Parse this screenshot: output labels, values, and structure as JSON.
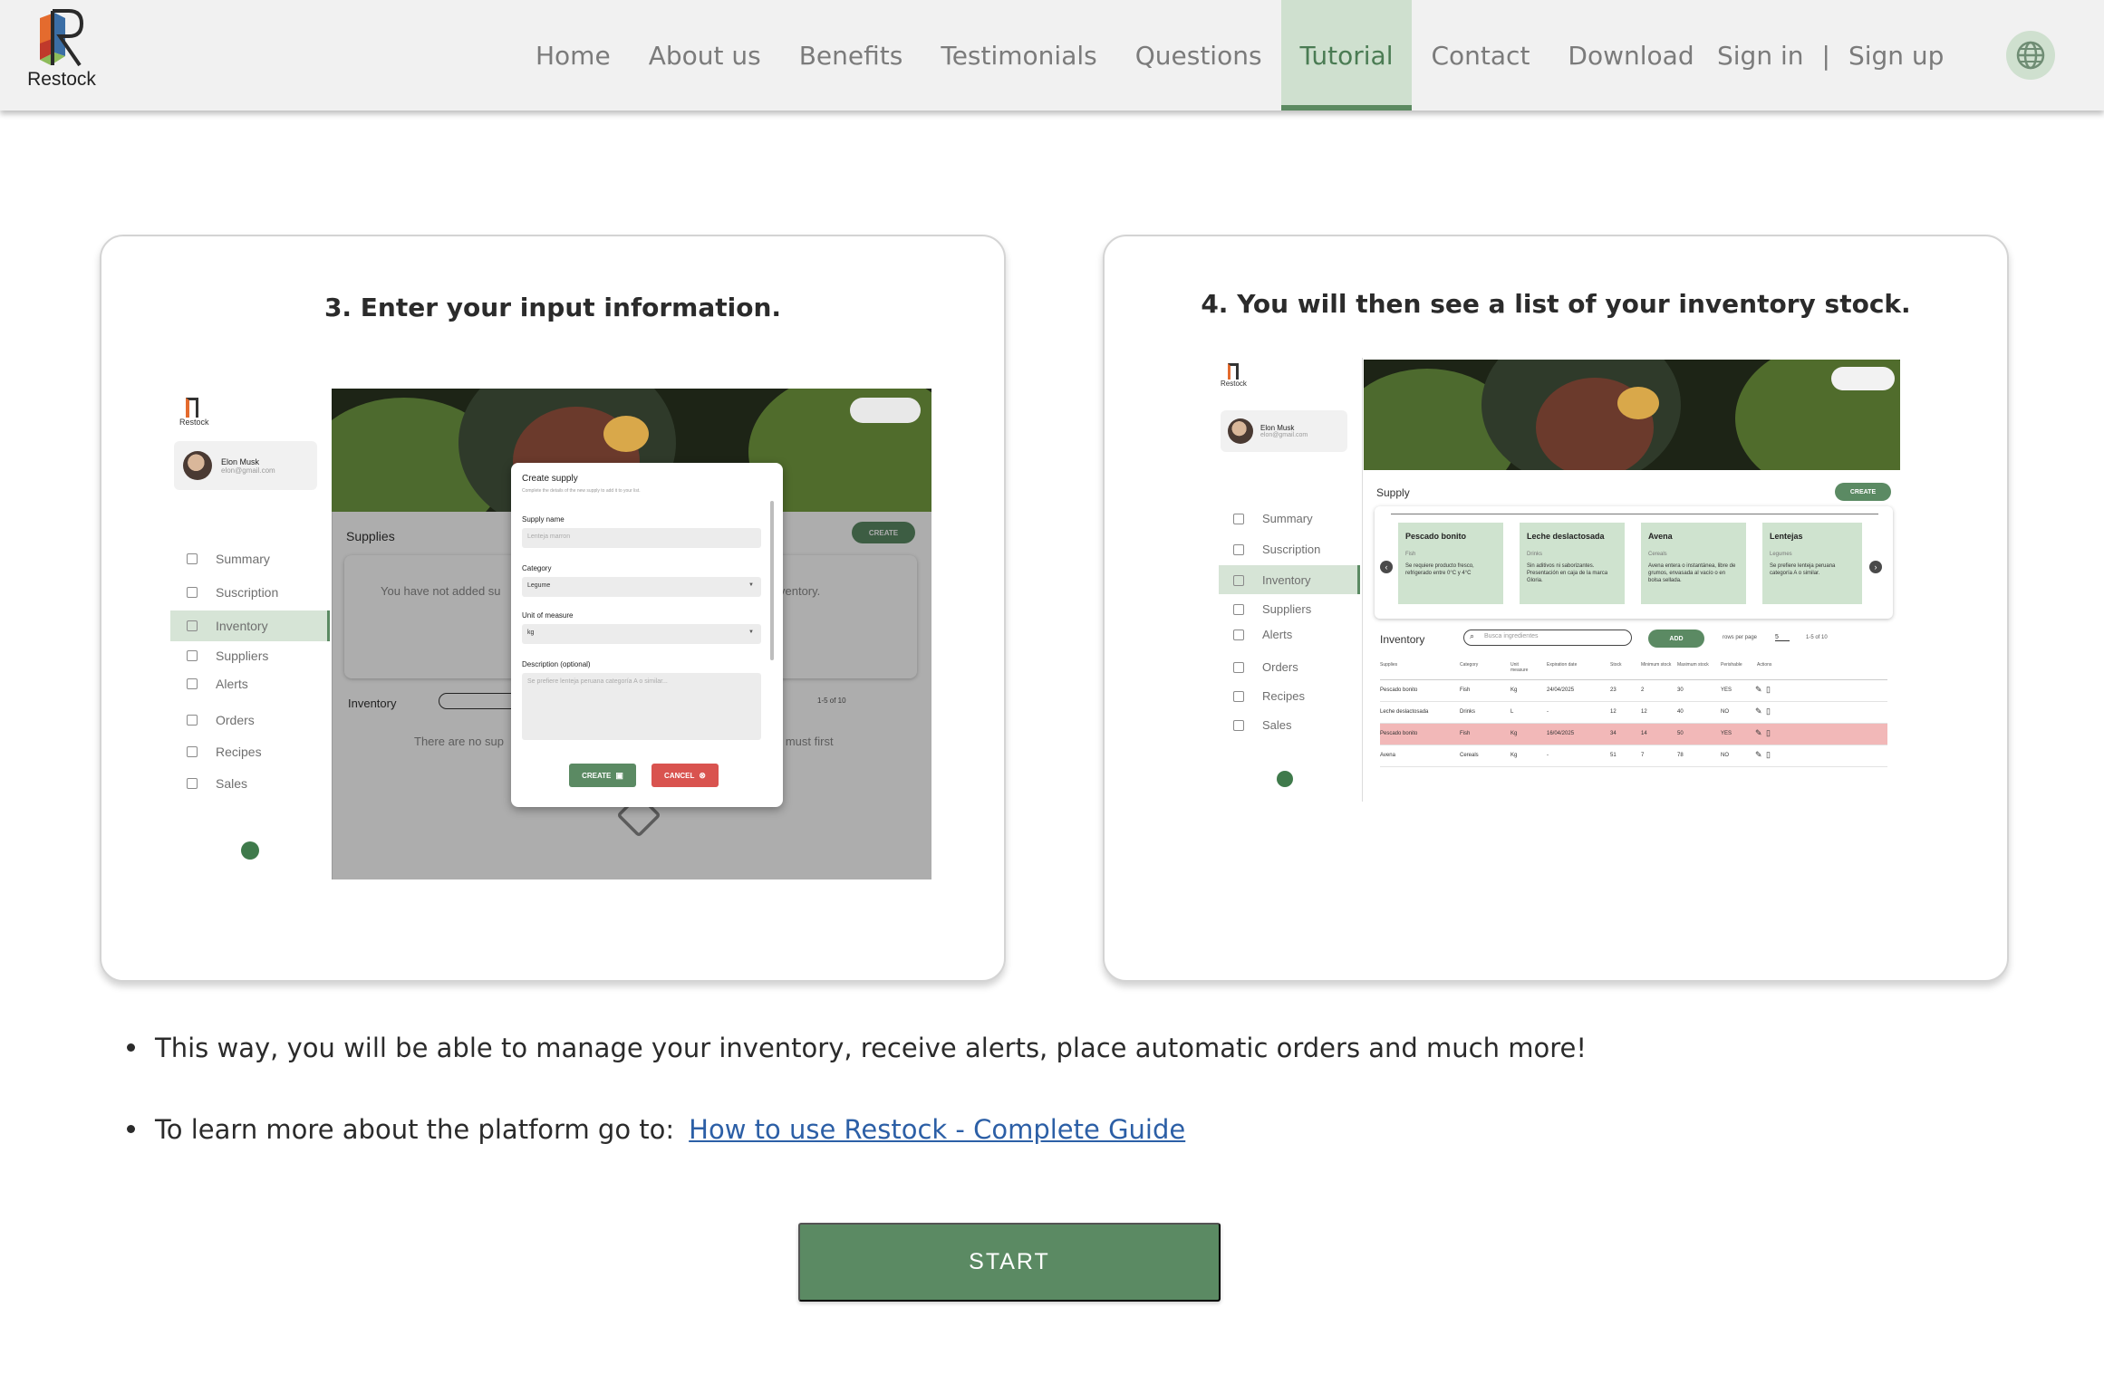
{
  "brand": {
    "name": "Restock"
  },
  "nav": {
    "items": [
      "Home",
      "About us",
      "Benefits",
      "Testimonials",
      "Questions",
      "Tutorial",
      "Contact",
      "Download"
    ],
    "active": "Tutorial",
    "sign_in": "Sign in",
    "separator": "|",
    "sign_up": "Sign up",
    "language_icon": "globe-icon"
  },
  "steps": [
    {
      "title": "3. Enter your input information.",
      "mock": {
        "brand": "Restock",
        "user_name": "Elon Musk",
        "user_email": "elon@gmail.com",
        "sidebar": [
          "Summary",
          "Suscription",
          "Inventory",
          "Suppliers",
          "Alerts",
          "Orders",
          "Recipes",
          "Sales"
        ],
        "active": "Inventory",
        "supplies_label": "Supplies",
        "create_label": "CREATE",
        "empty_text_left": "You have not added su",
        "empty_text_right": "ventory.",
        "inventory_label": "Inventory",
        "pagination": "1-5 of 10",
        "no_items_left": "There are no sup",
        "no_items_right": "u must first",
        "dialog": {
          "title": "Create supply",
          "subtitle": "Complete the details of the new supply to add it to your list.",
          "name_label": "Supply name",
          "name_placeholder": "Lenteja marron",
          "category_label": "Category",
          "category_value": "Legume",
          "unit_label": "Unit of measure",
          "unit_value": "kg",
          "desc_label": "Description (optional)",
          "desc_placeholder": "Se prefiere lenteja peruana categoría A o similar...",
          "create_button": "CREATE",
          "cancel_button": "CANCEL"
        }
      }
    },
    {
      "title": "4. You will then see a list of your inventory stock.",
      "mock": {
        "brand": "Restock",
        "user_name": "Elon Musk",
        "user_email": "elon@gmail.com",
        "sidebar": [
          "Summary",
          "Suscription",
          "Inventory",
          "Suppliers",
          "Alerts",
          "Orders",
          "Recipes",
          "Sales"
        ],
        "active": "Inventory",
        "supply_label": "Supply",
        "create_label": "CREATE",
        "cards": [
          {
            "name": "Pescado bonito",
            "category": "Fish",
            "desc": "Se requiere producto fresco, refrigerado entre 0°C y 4°C"
          },
          {
            "name": "Leche deslactosada",
            "category": "Drinks",
            "desc": "Sin aditivos ni saborizantes. Presentación en caja de la marca Gloria."
          },
          {
            "name": "Avena",
            "category": "Cereals",
            "desc": "Avena entera o instantánea, libre de grumos, envasada al vacío o en bolsa sellada."
          },
          {
            "name": "Lentejas",
            "category": "Legumes",
            "desc": "Se prefiere lenteja peruana categoría A o similar."
          }
        ],
        "inventory_label": "Inventory",
        "search_placeholder": "Busca ingredientes",
        "add_label": "ADD",
        "rows_per_page": "rows per page",
        "rows_value": "5",
        "pagination": "1-5 of 10",
        "columns": [
          "Supplies",
          "Category",
          "Unit measure",
          "Expiration date",
          "Stock",
          "Minimum stock",
          "Maximum stock",
          "Perishable",
          "Actions"
        ],
        "rows": [
          [
            "Pescado bonito",
            "Fish",
            "Kg",
            "24/04/2025",
            "23",
            "2",
            "30",
            "YES"
          ],
          [
            "Leche deslactosada",
            "Drinks",
            "L",
            "-",
            "12",
            "12",
            "40",
            "NO"
          ],
          [
            "Pescado bonito",
            "Fish",
            "Kg",
            "16/04/2025",
            "34",
            "14",
            "50",
            "YES"
          ],
          [
            "Avena",
            "Cereals",
            "Kg",
            "-",
            "51",
            "7",
            "78",
            "NO"
          ]
        ],
        "highlight_row": 2
      }
    }
  ],
  "bullets": {
    "first": "This way, you will be able to manage your inventory, receive alerts, place automatic orders and much more!",
    "second_prefix": "To learn more about the platform go to:",
    "second_link": "How to use Restock - Complete Guide"
  },
  "start_button": "START",
  "colors": {
    "accent": "#5b8a63",
    "active_bg": "#cfe0cf",
    "link": "#2c5fa6",
    "danger": "#d9534f",
    "highlight_row": "#f2b8b8"
  }
}
